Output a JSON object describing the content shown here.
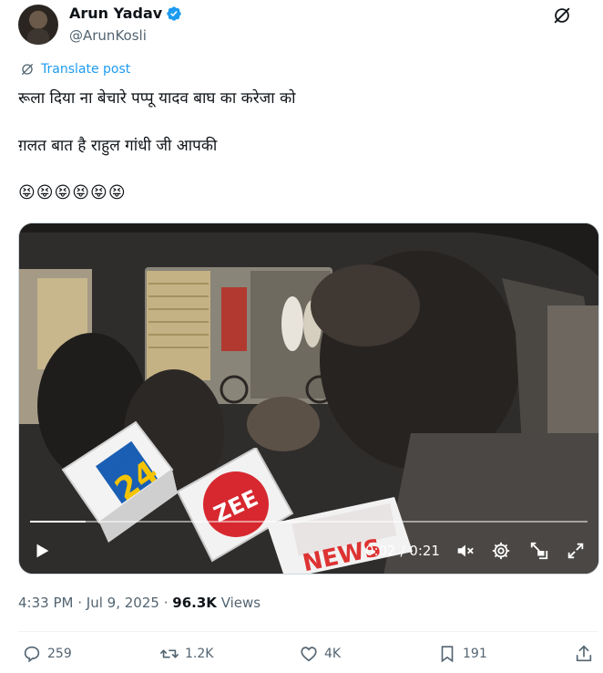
{
  "author": {
    "display_name": "Arun Yadav",
    "handle": "@ArunKosli"
  },
  "translate_label": "Translate post",
  "tweet": {
    "lines": [
      "रूला दिया ना बेचारे पप्पू यादव बाघ का करेजा को",
      "ग़लत बात है राहुल गांधी जी आपकी",
      "😝😝😝😝😝😝"
    ]
  },
  "video": {
    "time_display": "0:02 / 0:21",
    "progress_fraction": 0.1,
    "mic_labels": {
      "news24_top": "NEWS",
      "news24_num": "24",
      "zee": "ZEE",
      "abp": "NEWS"
    }
  },
  "meta": {
    "time": "4:33 PM",
    "separator": "·",
    "date": "Jul 9, 2025",
    "views_count": "96.3K",
    "views_label": "Views"
  },
  "actions": {
    "replies": "259",
    "reposts": "1.2K",
    "likes": "4K",
    "bookmarks": "191"
  },
  "colors": {
    "accent": "#1d9bf0",
    "secondary_text": "#536471"
  }
}
